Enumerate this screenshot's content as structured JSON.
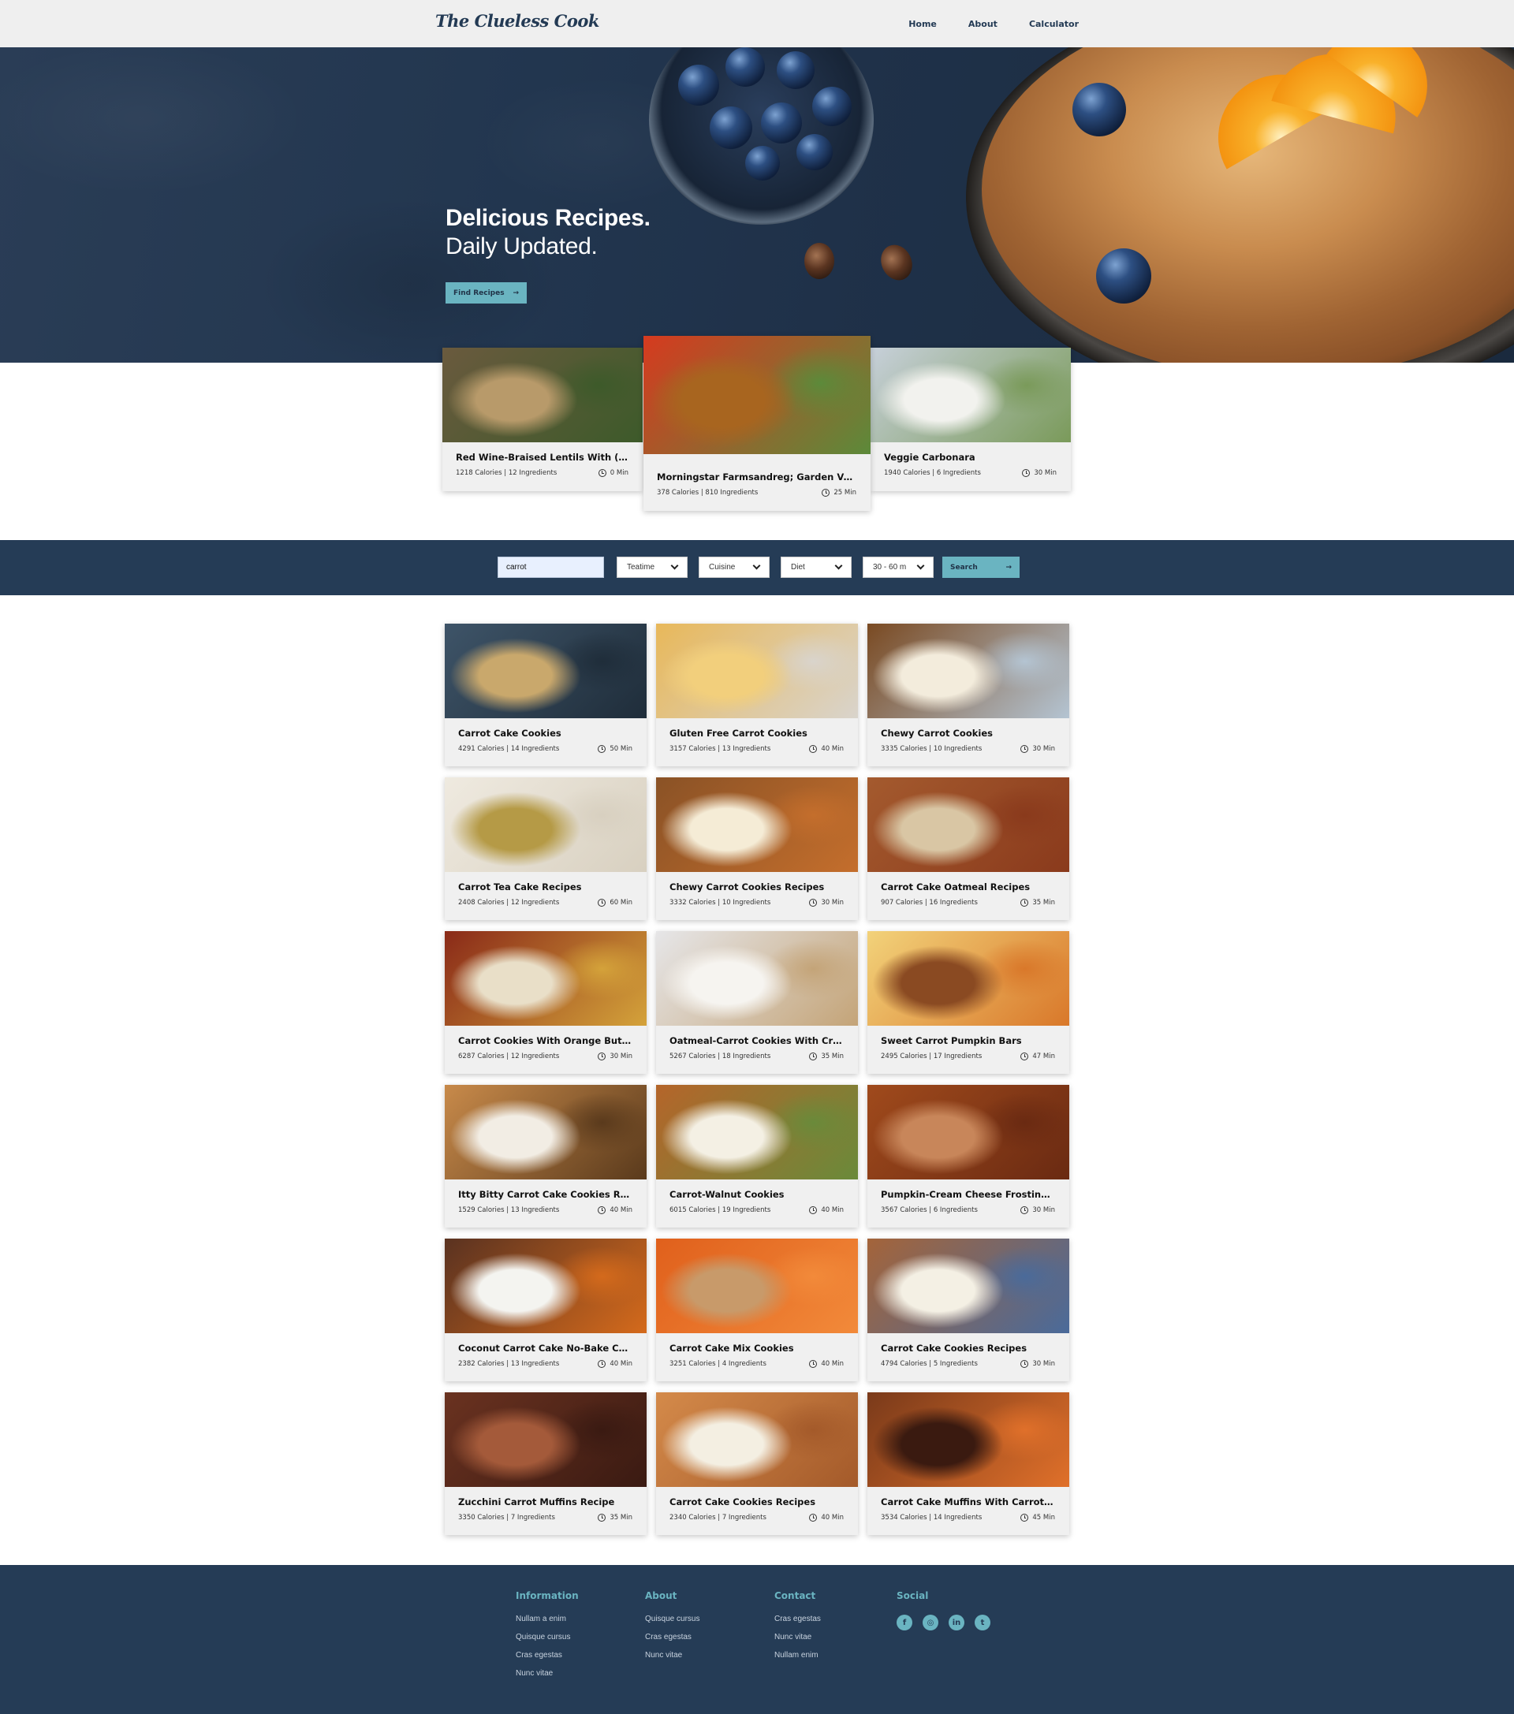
{
  "nav": {
    "logo": "The Clueless Cook",
    "links": [
      "Home",
      "About",
      "Calculator"
    ]
  },
  "hero": {
    "title": "Delicious Recipes.",
    "subtitle": "Daily Updated.",
    "button": "Find Recipes",
    "button_arrow": "→"
  },
  "featured": [
    {
      "title": "Red Wine-Braised Lentils With (Ve...",
      "meta": "1218 Calories | 12 Ingredients",
      "time": "0 Min",
      "colors": [
        "#6a5a3e",
        "#b89a6a",
        "#3d5a2a"
      ]
    },
    {
      "title": "Morningstar Farmsandreg; Garden Veg...",
      "meta": "378 Calories | 810 Ingredients",
      "time": "25 Min",
      "colors": [
        "#d63a1f",
        "#a8651f",
        "#5c8a3a"
      ]
    },
    {
      "title": "Veggie Carbonara",
      "meta": "1940 Calories | 6 Ingredients",
      "time": "30 Min",
      "colors": [
        "#c7d0da",
        "#f2f2ee",
        "#7a9a5a"
      ]
    }
  ],
  "search": {
    "query": "carrot",
    "selects": [
      "Teatime",
      "Cuisine",
      "Diet",
      "30 - 60 m"
    ],
    "button": "Search",
    "button_arrow": "→"
  },
  "recipes": [
    {
      "title": "Carrot Cake Cookies",
      "meta": "4291 Calories | 14 Ingredients",
      "time": "50 Min",
      "colors": [
        "#3e5468",
        "#c9a86c",
        "#1f2d3a"
      ]
    },
    {
      "title": "Gluten Free Carrot Cookies",
      "meta": "3157 Calories | 13 Ingredients",
      "time": "40 Min",
      "colors": [
        "#e8b85a",
        "#f2cf7c",
        "#d9d4cc"
      ]
    },
    {
      "title": "Chewy Carrot Cookies",
      "meta": "3335 Calories | 10 Ingredients",
      "time": "30 Min",
      "colors": [
        "#7a4a22",
        "#f3ecdc",
        "#b4c4d2"
      ]
    },
    {
      "title": "Carrot Tea Cake Recipes",
      "meta": "2408 Calories | 12 Ingredients",
      "time": "60 Min",
      "colors": [
        "#efeae0",
        "#b59a46",
        "#d8d0c0"
      ]
    },
    {
      "title": "Chewy Carrot Cookies Recipes",
      "meta": "3332 Calories | 10 Ingredients",
      "time": "30 Min",
      "colors": [
        "#8a5226",
        "#f5ecd6",
        "#c46e2c"
      ]
    },
    {
      "title": "Carrot Cake Oatmeal Recipes",
      "meta": "907 Calories | 16 Ingredients",
      "time": "35 Min",
      "colors": [
        "#a45a2e",
        "#d9c6a4",
        "#8a3a1c"
      ]
    },
    {
      "title": "Carrot Cookies With Orange Butter...",
      "meta": "6287 Calories | 12 Ingredients",
      "time": "30 Min",
      "colors": [
        "#8a2a18",
        "#e9dfc8",
        "#d4a23a"
      ]
    },
    {
      "title": "Oatmeal-Carrot Cookies With Cre...",
      "meta": "5267 Calories | 18 Ingredients",
      "time": "35 Min",
      "colors": [
        "#e6e6e8",
        "#f6f4f0",
        "#c4a478"
      ]
    },
    {
      "title": "Sweet Carrot Pumpkin Bars",
      "meta": "2495 Calories | 17 Ingredients",
      "time": "47 Min",
      "colors": [
        "#f2d27a",
        "#8a4a22",
        "#d9782a"
      ]
    },
    {
      "title": "Itty Bitty Carrot Cake Cookies Reci...",
      "meta": "1529 Calories | 13 Ingredients",
      "time": "40 Min",
      "colors": [
        "#c88a4a",
        "#f2ede4",
        "#5a3a1c"
      ]
    },
    {
      "title": "Carrot-Walnut Cookies",
      "meta": "6015 Calories | 19 Ingredients",
      "time": "40 Min",
      "colors": [
        "#b5652a",
        "#f4f0e4",
        "#6a8a3a"
      ]
    },
    {
      "title": "Pumpkin-Cream Cheese Frosting ...",
      "meta": "3567 Calories | 6 Ingredients",
      "time": "30 Min",
      "colors": [
        "#a04a1c",
        "#c8865a",
        "#6a2a12"
      ]
    },
    {
      "title": "Coconut Carrot Cake No-Bake Co...",
      "meta": "2382 Calories | 13 Ingredients",
      "time": "40 Min",
      "colors": [
        "#5a3220",
        "#f4f4f0",
        "#d46a1c"
      ]
    },
    {
      "title": "Carrot Cake Mix Cookies",
      "meta": "3251 Calories | 4 Ingredients",
      "time": "40 Min",
      "colors": [
        "#e0601c",
        "#c89a6a",
        "#f28a3a"
      ]
    },
    {
      "title": "Carrot Cake Cookies Recipes",
      "meta": "4794 Calories | 5 Ingredients",
      "time": "30 Min",
      "colors": [
        "#a4643a",
        "#f4f0e4",
        "#4a6a9a"
      ]
    },
    {
      "title": "Zucchini Carrot Muffins Recipe",
      "meta": "3350 Calories | 7 Ingredients",
      "time": "35 Min",
      "colors": [
        "#6a3220",
        "#a45a3a",
        "#3a1a12"
      ]
    },
    {
      "title": "Carrot Cake Cookies Recipes",
      "meta": "2340 Calories | 7 Ingredients",
      "time": "40 Min",
      "colors": [
        "#d48a4a",
        "#f4efe2",
        "#a45a2a"
      ]
    },
    {
      "title": "Carrot Cake Muffins With Carrot J...",
      "meta": "3534 Calories | 14 Ingredients",
      "time": "45 Min",
      "colors": [
        "#7a3a1a",
        "#3a1a10",
        "#e0702a"
      ]
    }
  ],
  "footer": {
    "columns": [
      {
        "heading": "Information",
        "links": [
          "Nullam a enim",
          "Quisque cursus",
          "Cras egestas",
          "Nunc vitae"
        ]
      },
      {
        "heading": "About",
        "links": [
          "Quisque cursus",
          "Cras egestas",
          "Nunc vitae"
        ]
      },
      {
        "heading": "Contact",
        "links": [
          "Cras egestas",
          "Nunc vitae",
          "Nullam enim"
        ]
      }
    ],
    "social_heading": "Social",
    "social": [
      {
        "icon": "facebook-icon",
        "glyph": "f"
      },
      {
        "icon": "instagram-icon",
        "glyph": "◎"
      },
      {
        "icon": "linkedin-icon",
        "glyph": "in"
      },
      {
        "icon": "twitter-icon",
        "glyph": "t"
      }
    ]
  },
  "colors": {
    "navy": "#253c56",
    "accent": "#6ab4c1",
    "nav_bg": "#efefef",
    "card_bg": "#f0f0f0"
  }
}
